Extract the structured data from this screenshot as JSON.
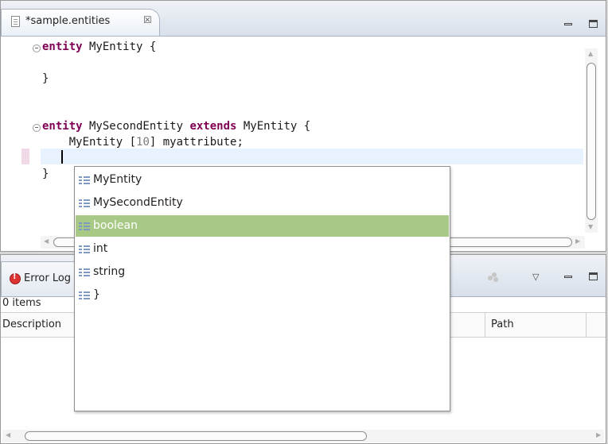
{
  "editor": {
    "tab_title": "*sample.entities",
    "tab_close_glyph": "☒",
    "icons": {
      "file": "document-icon",
      "close": "close-icon",
      "minimize": "minimize-icon",
      "maximize": "maximize-icon"
    },
    "code": {
      "line1_kw": "entity",
      "line1_rest": " MyEntity {",
      "line3": "}",
      "line5_kw1": "entity",
      "line5_mid": " MySecondEntity ",
      "line5_kw2": "extends",
      "line5_rest": " MyEntity {",
      "line6_pre": "    MyEntity [",
      "line6_num": "10",
      "line6_post": "] myattribute;",
      "line8": "}"
    }
  },
  "error_log": {
    "tab_label": "Error Log",
    "item_count": "0 items",
    "columns": {
      "description": "Description",
      "path": "Path"
    },
    "icons": {
      "error": "error-log-icon",
      "view_menu": "view-menu-icon",
      "gear": "gear-icon"
    }
  },
  "content_assist": {
    "items": [
      {
        "label": "MyEntity",
        "selected": false
      },
      {
        "label": "MySecondEntity",
        "selected": false
      },
      {
        "label": "boolean",
        "selected": true
      },
      {
        "label": "int",
        "selected": false
      },
      {
        "label": "string",
        "selected": false
      },
      {
        "label": "}",
        "selected": false
      }
    ],
    "item_icon": "proposal-icon",
    "selected_color": "#a8c986"
  },
  "colors": {
    "keyword": "#7f0055",
    "current_line": "#e8f2fe",
    "number": "#7a7a7a"
  }
}
